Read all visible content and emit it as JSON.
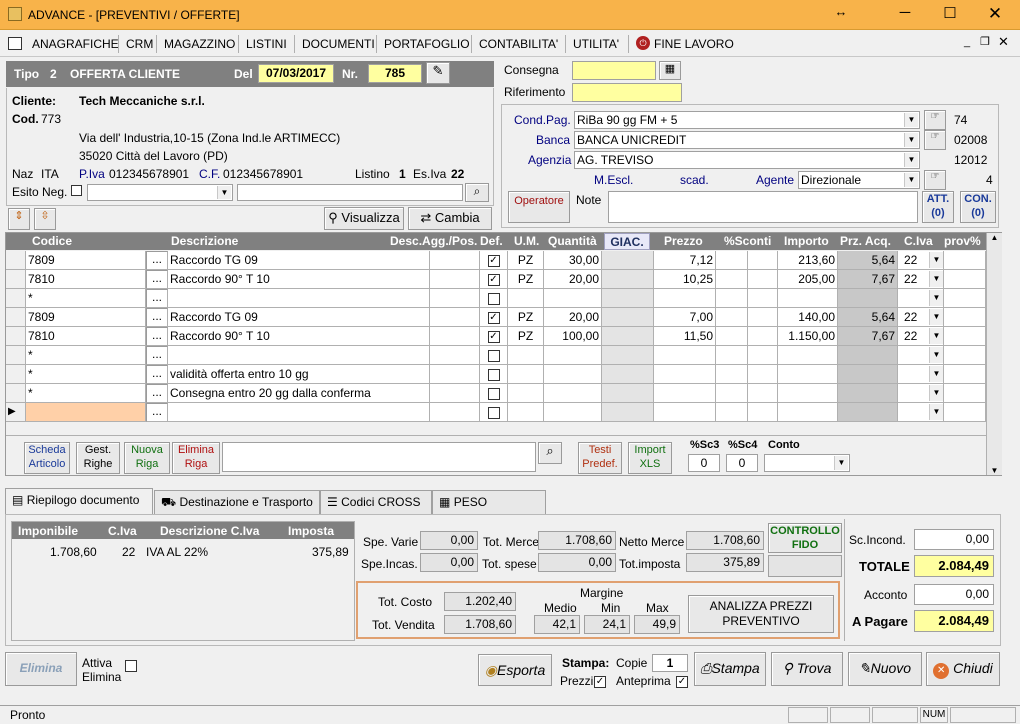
{
  "titlebar": {
    "title": "ADVANCE - [PREVENTIVI / OFFERTE]"
  },
  "menu": [
    "ANAGRAFICHE",
    "CRM",
    "MAGAZZINO",
    "LISTINI",
    "DOCUMENTI",
    "PORTAFOGLIO",
    "CONTABILITA'",
    "UTILITA'",
    "FINE LAVORO"
  ],
  "doc": {
    "tipo_label": "Tipo",
    "tipo_num": "2",
    "tipo_desc": "OFFERTA CLIENTE",
    "del_label": "Del",
    "date": "07/03/2017",
    "nr_label": "Nr.",
    "nr": "785"
  },
  "consegna": {
    "label": "Consegna",
    "value": "",
    "rif_label": "Riferimento",
    "rif_value": ""
  },
  "client": {
    "label": "Cliente:",
    "name": "Tech Meccaniche s.r.l.",
    "cod_label": "Cod.",
    "cod": "773",
    "address": "Via dell' Industria,10-15 (Zona Ind.le ARTIMECC)",
    "city": "35020 Città del Lavoro (PD)",
    "naz_label": "Naz",
    "naz": "ITA",
    "piva_label": "P.Iva",
    "piva": "012345678901",
    "cf_label": "C.F.",
    "cf": "012345678901",
    "listino_label": "Listino",
    "listino": "1",
    "esiva_label": "Es.Iva",
    "esiva": "22",
    "esito_label": "Esito Neg."
  },
  "buttons": {
    "visualizza": "Visualizza",
    "cambia": "Cambia"
  },
  "payment": {
    "cond_label": "Cond.Pag.",
    "cond": "RiBa 90 gg FM + 5",
    "cond_code": "74",
    "banca_label": "Banca",
    "banca": "BANCA UNICREDIT",
    "banca_code": "02008",
    "agenzia_label": "Agenzia",
    "agenzia": "AG. TREVISO",
    "agenzia_code": "12012",
    "mescl": "M.Escl.",
    "scad": "scad.",
    "agente_label": "Agente",
    "agente": "Direzionale",
    "agente_code": "4",
    "operatore": "Operatore",
    "note_label": "Note",
    "att": "ATT.",
    "att_n": "(0)",
    "con": "CON.",
    "con_n": "(0)"
  },
  "grid": {
    "headers": [
      "Codice",
      "Descrizione",
      "Desc.Agg./Pos.",
      "Def.",
      "U.M.",
      "Quantità",
      "GIAC.",
      "Prezzo",
      "%Sconti",
      "Importo",
      "Prz. Acq.",
      "C.Iva",
      "prov%"
    ],
    "rows": [
      {
        "code": "7809",
        "desc": "Raccordo TG 09",
        "def": true,
        "um": "PZ",
        "qty": "30,00",
        "price": "7,12",
        "imp": "213,60",
        "acq": "5,64",
        "iva": "22"
      },
      {
        "code": "7810",
        "desc": "Raccordo 90° T 10",
        "def": true,
        "um": "PZ",
        "qty": "20,00",
        "price": "10,25",
        "imp": "205,00",
        "acq": "7,67",
        "iva": "22"
      },
      {
        "code": "*",
        "desc": "",
        "def": false,
        "um": "",
        "qty": "",
        "price": "",
        "imp": "",
        "acq": "",
        "iva": ""
      },
      {
        "code": "7809",
        "desc": "Raccordo TG 09",
        "def": true,
        "um": "PZ",
        "qty": "20,00",
        "price": "7,00",
        "imp": "140,00",
        "acq": "5,64",
        "iva": "22"
      },
      {
        "code": "7810",
        "desc": "Raccordo 90° T 10",
        "def": true,
        "um": "PZ",
        "qty": "100,00",
        "price": "11,50",
        "imp": "1.150,00",
        "acq": "7,67",
        "iva": "22"
      },
      {
        "code": "*",
        "desc": "",
        "def": false,
        "um": "",
        "qty": "",
        "price": "",
        "imp": "",
        "acq": "",
        "iva": ""
      },
      {
        "code": "*",
        "desc": "validità offerta entro 10 gg",
        "def": false,
        "um": "",
        "qty": "",
        "price": "",
        "imp": "",
        "acq": "",
        "iva": ""
      },
      {
        "code": "*",
        "desc": "Consegna entro 20 gg dalla conferma",
        "def": false,
        "um": "",
        "qty": "",
        "price": "",
        "imp": "",
        "acq": "",
        "iva": ""
      },
      {
        "code": "",
        "desc": "",
        "def": false,
        "um": "",
        "qty": "",
        "price": "",
        "imp": "",
        "acq": "",
        "iva": ""
      }
    ]
  },
  "gridbar": {
    "scheda": "Scheda",
    "articolo": "Articolo",
    "gest": "Gest.",
    "righe": "Righe",
    "nuova": "Nuova",
    "riga": "Riga",
    "elimina": "Elimina",
    "riga2": "Riga",
    "testi": "Testi",
    "predef": "Predef.",
    "import": "Import",
    "xls": "XLS",
    "sc3_label": "%Sc3",
    "sc3": "0",
    "sc4_label": "%Sc4",
    "sc4": "0",
    "conto_label": "Conto"
  },
  "tabs": [
    "Riepilogo documento",
    "Destinazione e Trasporto",
    "Codici CROSS",
    "PESO GRAMMI"
  ],
  "iva": {
    "headers": [
      "Imponibile",
      "C.Iva",
      "Descrizione C.Iva",
      "Imposta"
    ],
    "imponibile": "1.708,60",
    "civa": "22",
    "desc": "IVA AL 22%",
    "imposta": "375,89"
  },
  "totals": {
    "spe_varie_label": "Spe. Varie",
    "spe_varie": "0,00",
    "spe_incas_label": "Spe.Incas.",
    "spe_incas": "0,00",
    "tot_merce_label": "Tot. Merce",
    "tot_merce": "1.708,60",
    "tot_spese_label": "Tot. spese",
    "tot_spese": "0,00",
    "netto_label": "Netto Merce",
    "netto": "1.708,60",
    "totimp_label": "Tot.imposta",
    "totimp": "375,89",
    "controllo": "CONTROLLO",
    "fido": "FIDO",
    "tot_costo_label": "Tot. Costo",
    "tot_costo": "1.202,40",
    "tot_vendita_label": "Tot. Vendita",
    "tot_vendita": "1.708,60",
    "margine": "Margine",
    "medio": "Medio",
    "min": "Min",
    "max": "Max",
    "medio_v": "42,1",
    "min_v": "24,1",
    "max_v": "49,9",
    "analizza": "ANALIZZA PREZZI",
    "preventivo": "PREVENTIVO",
    "sc_incond_label": "Sc.Incond.",
    "sc_incond": "0,00",
    "totale_label": "TOTALE",
    "totale": "2.084,49",
    "acconto_label": "Acconto",
    "acconto": "0,00",
    "apagare_label": "A Pagare",
    "apagare": "2.084,49"
  },
  "bottom": {
    "elimina": "Elimina",
    "attiva": "Attiva",
    "elimina2": "Elimina",
    "esporta": "Esporta",
    "stampa_label": "Stampa:",
    "copie_label": "Copie",
    "copie": "1",
    "prezzi": "Prezzi",
    "anteprima": "Anteprima",
    "stampa": "Stampa",
    "trova": "Trova",
    "nuovo": "Nuovo",
    "chiudi": "Chiudi"
  },
  "status": {
    "text": "Pronto",
    "num": "NUM"
  }
}
